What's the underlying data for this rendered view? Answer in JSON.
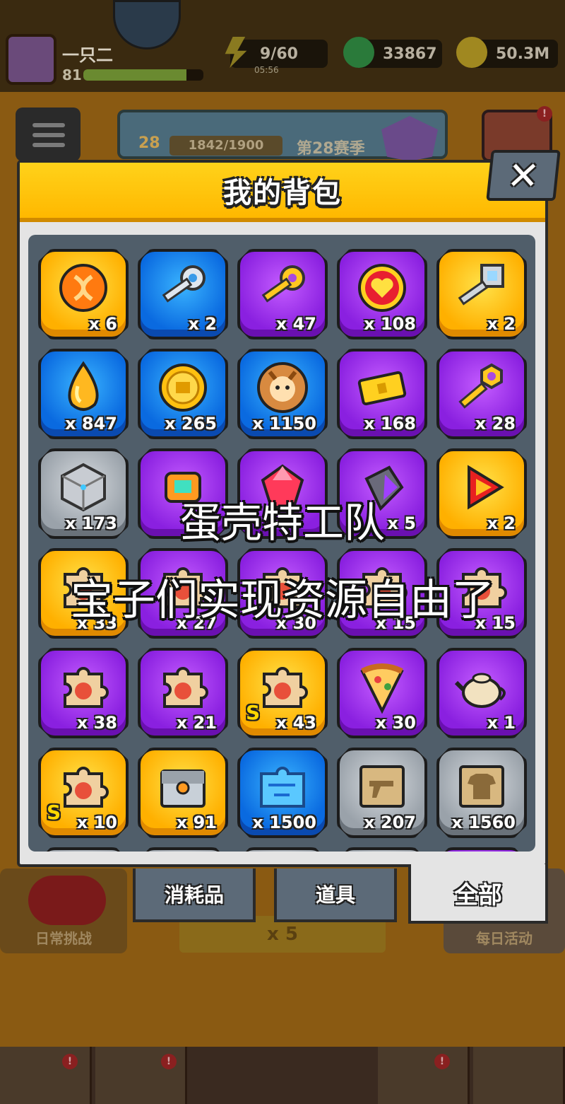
{
  "hud": {
    "player_name": "一只二",
    "player_level": "81",
    "xp_fraction": 0.86,
    "energy": "9/60",
    "energy_timer": "05:56",
    "gems": "33867",
    "coins": "50.3M"
  },
  "season": {
    "level": "28",
    "progress": "1842/1900",
    "name": "第28赛季"
  },
  "background": {
    "daily_challenge": "日常挑战",
    "daily_activity": "每日活动",
    "center_multiplier": "x 5"
  },
  "backpack": {
    "title": "我的背包",
    "close_label": "✕",
    "items": [
      {
        "name": "orange-dna-token",
        "rarity": "gold",
        "icon": "orange-dna-orb-icon",
        "qty": "x 6"
      },
      {
        "name": "silver-key",
        "rarity": "blue",
        "icon": "silver-key-icon",
        "qty": "x 2"
      },
      {
        "name": "gold-key",
        "rarity": "purple",
        "icon": "gold-key-icon",
        "qty": "x 47"
      },
      {
        "name": "heart-medal",
        "rarity": "purple",
        "icon": "heart-medal-icon",
        "qty": "x 108"
      },
      {
        "name": "crystal-key",
        "rarity": "gold",
        "icon": "crystal-key-icon",
        "qty": "x 2"
      },
      {
        "name": "golden-drop",
        "rarity": "blue",
        "icon": "golden-drop-icon",
        "qty": "x 847"
      },
      {
        "name": "gold-coin",
        "rarity": "blue",
        "icon": "gold-coin-icon",
        "qty": "x 265"
      },
      {
        "name": "dog-cookie",
        "rarity": "blue",
        "icon": "dog-cookie-icon",
        "qty": "x 1150"
      },
      {
        "name": "gold-ticket",
        "rarity": "purple",
        "icon": "gold-ticket-icon",
        "qty": "x 168"
      },
      {
        "name": "hex-key",
        "rarity": "purple",
        "icon": "hex-key-icon",
        "qty": "x 28"
      },
      {
        "name": "metal-cube",
        "rarity": "gray",
        "icon": "metal-cube-icon",
        "qty": "x 173"
      },
      {
        "name": "gadget-orange",
        "rarity": "purple",
        "icon": "gadget-icon",
        "qty": ""
      },
      {
        "name": "red-gem",
        "rarity": "purple",
        "icon": "red-gem-icon",
        "qty": ""
      },
      {
        "name": "purple-crystal",
        "rarity": "purple",
        "icon": "purple-crystal-icon",
        "qty": "x 5"
      },
      {
        "name": "red-triangle-chip",
        "rarity": "gold",
        "icon": "red-triangle-icon",
        "qty": "x 2"
      },
      {
        "name": "puzzle-gold-a",
        "rarity": "gold",
        "icon": "puzzle-piece-icon",
        "qty": "x 33"
      },
      {
        "name": "puzzle-purple-a",
        "rarity": "purple",
        "icon": "puzzle-piece-icon",
        "qty": "x 27"
      },
      {
        "name": "puzzle-purple-b",
        "rarity": "purple",
        "icon": "puzzle-piece-icon",
        "qty": "x 30"
      },
      {
        "name": "puzzle-purple-c",
        "rarity": "purple",
        "icon": "puzzle-piece-icon",
        "qty": "x 15"
      },
      {
        "name": "puzzle-purple-d",
        "rarity": "purple",
        "icon": "puzzle-piece-icon",
        "qty": "x 15"
      },
      {
        "name": "puzzle-redhead",
        "rarity": "purple",
        "icon": "puzzle-piece-icon",
        "qty": "x 38"
      },
      {
        "name": "puzzle-pinkhair",
        "rarity": "purple",
        "icon": "puzzle-piece-icon",
        "qty": "x 21"
      },
      {
        "name": "puzzle-skull-s",
        "rarity": "gold",
        "icon": "puzzle-piece-icon",
        "qty": "x 43",
        "s": true
      },
      {
        "name": "pizza-slice",
        "rarity": "purple",
        "icon": "pizza-slice-icon",
        "qty": "x 30"
      },
      {
        "name": "teapot",
        "rarity": "purple",
        "icon": "teapot-icon",
        "qty": "x 1"
      },
      {
        "name": "puzzle-blonde-s",
        "rarity": "gold",
        "icon": "puzzle-piece-icon",
        "qty": "x 10",
        "s": true
      },
      {
        "name": "treasure-chest",
        "rarity": "gold",
        "icon": "treasure-chest-icon",
        "qty": "x 91"
      },
      {
        "name": "blue-puzzle",
        "rarity": "blue",
        "icon": "blue-puzzle-icon",
        "qty": "x 1500"
      },
      {
        "name": "gun-blueprint",
        "rarity": "gray",
        "icon": "gun-scroll-icon",
        "qty": "x 207"
      },
      {
        "name": "shirt-blueprint",
        "rarity": "gray",
        "icon": "shirt-scroll-icon",
        "qty": "x 1560"
      },
      {
        "name": "row7-1",
        "rarity": "gray",
        "icon": "",
        "qty": ""
      },
      {
        "name": "row7-2",
        "rarity": "gray",
        "icon": "",
        "qty": ""
      },
      {
        "name": "row7-3",
        "rarity": "gray",
        "icon": "",
        "qty": ""
      },
      {
        "name": "row7-4",
        "rarity": "gray",
        "icon": "",
        "qty": ""
      },
      {
        "name": "row7-5",
        "rarity": "purple",
        "icon": "",
        "qty": ""
      }
    ],
    "s_label": "S"
  },
  "tabs": {
    "consumables": "消耗品",
    "items": "道具",
    "all": "全部"
  },
  "captions": {
    "line1": "蛋壳特工队",
    "line2": "宝子们实现资源自由了"
  },
  "colors": {
    "header_yellow": "#ffc400",
    "rarity_gold": "#ffb000",
    "rarity_blue": "#0a6ae0",
    "rarity_purple": "#8a20e0",
    "rarity_gray": "#9aa2aa",
    "tab_gray": "#5c6a78"
  }
}
